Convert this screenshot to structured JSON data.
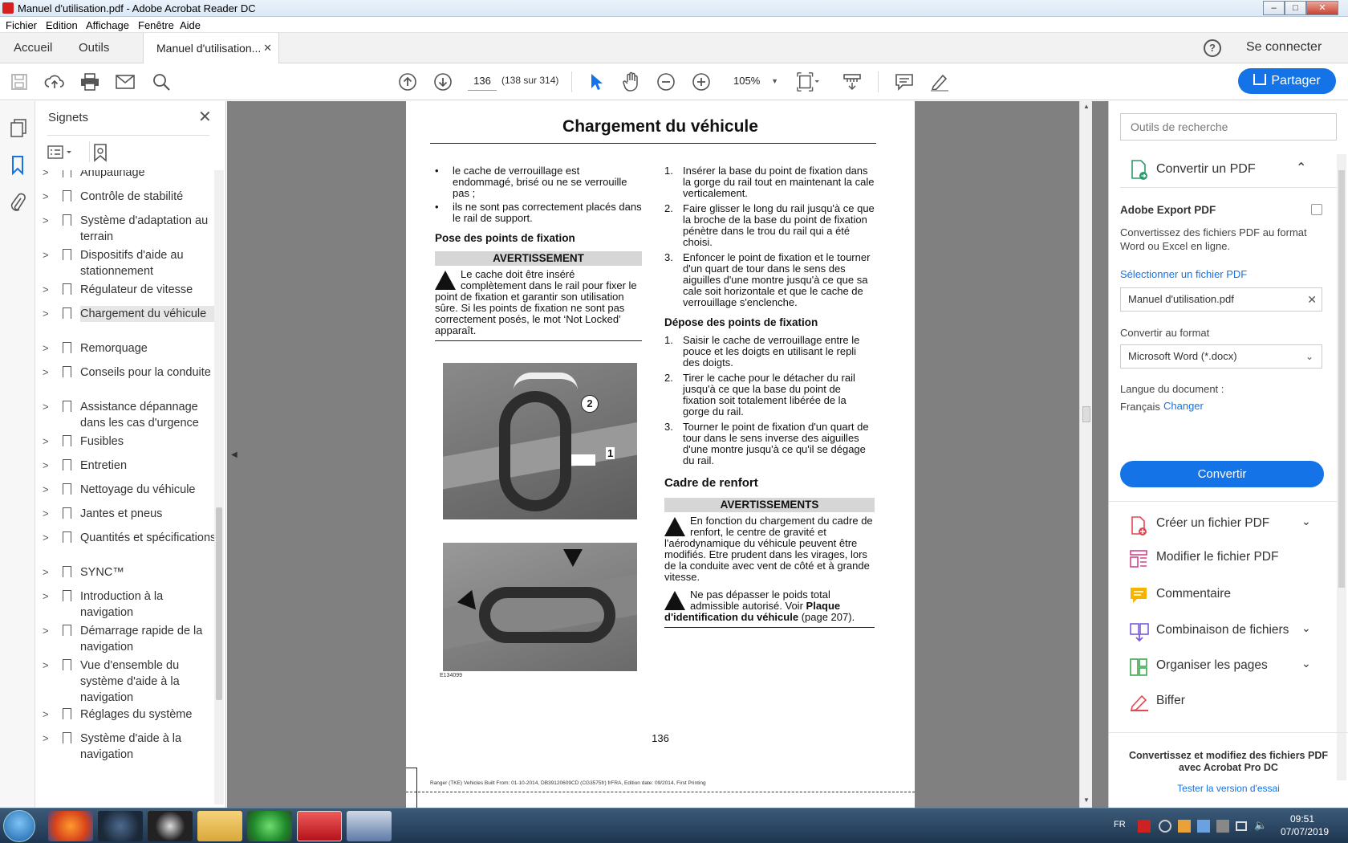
{
  "window": {
    "title": "Manuel d'utilisation.pdf - Adobe Acrobat Reader DC",
    "min_label": "–",
    "max_label": "□",
    "close_label": "✕"
  },
  "menu": [
    "Fichier",
    "Edition",
    "Affichage",
    "Fenêtre",
    "Aide"
  ],
  "tabs": {
    "home": "Accueil",
    "tools": "Outils",
    "doc": "Manuel d'utilisation...",
    "help": "?",
    "login": "Se connecter"
  },
  "toolbar": {
    "page_number": "136",
    "page_count": "(138 sur 314)",
    "zoom": "105%",
    "share": "Partager"
  },
  "bookmarks": {
    "title": "Signets",
    "items": [
      "Antipatinage",
      "Contrôle de stabilité",
      "Système d'adaptation au terrain",
      "Dispositifs d'aide au stationnement",
      "Régulateur de vitesse",
      "Chargement du véhicule",
      "Remorquage",
      "Conseils pour la conduite",
      "Assistance dépannage dans les cas d'urgence",
      "Fusibles",
      "Entretien",
      "Nettoyage du véhicule",
      "Jantes et pneus",
      "Quantités et spécifications",
      "SYNC™",
      "Introduction à la navigation",
      "Démarrage rapide de la navigation",
      "Vue d'ensemble du système d'aide à la navigation",
      "Réglages du système",
      "Système d'aide à la navigation"
    ]
  },
  "page": {
    "heading": "Chargement du véhicule",
    "left": {
      "bullets": [
        "le cache de verrouillage est endommagé, brisé ou ne se verrouille pas ;",
        "ils ne sont pas correctement placés dans le rail de support."
      ],
      "sub1": "Pose des points de fixation",
      "warn_label": "AVERTISSEMENT",
      "warn_text": "Le cache doit être inséré complètement dans le rail pour fixer le point de fixation et garantir son utilisation sûre. Si les points de fixation ne sont pas correctement posés, le mot ‘Not Locked’ apparaît.",
      "callout_2": "2",
      "callout_1": "1",
      "figure_code": "E134099"
    },
    "right": {
      "steps1": [
        "Insérer la base du point de fixation dans la gorge du rail tout en maintenant la cale verticalement.",
        "Faire glisser le long du rail jusqu'à ce que la broche de la base du point de fixation pénètre dans le trou du rail qui a été choisi.",
        "Enfoncer le point de fixation et le tourner d'un quart de tour dans le sens des aiguilles d'une montre jusqu'à ce que sa cale soit horizontale et que le cache de verrouillage s'enclenche."
      ],
      "sub2": "Dépose des points de fixation",
      "steps2": [
        "Saisir le cache de verrouillage entre le pouce et les doigts en utilisant le repli des doigts.",
        "Tirer le cache pour le détacher du rail jusqu'à ce que la base du point de fixation soit totalement libérée de la gorge du rail.",
        "Tourner le point de fixation d'un quart de tour dans le sens inverse des aiguilles d'une montre jusqu'à ce qu'il se dégage du rail."
      ],
      "step_nums": [
        "1.",
        "2.",
        "3."
      ],
      "sub3": "Cadre de renfort",
      "warns_label": "AVERTISSEMENTS",
      "warn1": "En fonction du chargement du cadre de renfort, le centre de gravité et l'aérodynamique du véhicule peuvent être modifiés. Etre prudent dans les virages, lors de la conduite avec vent de côté et à grande vitesse.",
      "warn2_pre": "Ne pas dépasser le poids total admissible autorisé.  Voir",
      "warn2_bold": "Plaque d'identification du véhicule",
      "warn2_post": "(page 207)."
    },
    "page_number": "136",
    "footer": "Ranger (TKE) Vehicles Built From: 01-10-2014, DB39120609CD (CG3575fr) frFRA, Edition date: 09/2014, First Printing"
  },
  "right_panel": {
    "search_placeholder": "Outils de recherche",
    "convert_title": "Convertir un PDF",
    "export_title": "Adobe Export PDF",
    "export_desc": "Convertissez des fichiers PDF au format Word ou Excel en ligne.",
    "select_label": "Sélectionner un fichier PDF",
    "file_name": "Manuel d'utilisation.pdf",
    "format_label": "Convertir au format",
    "format_value": "Microsoft Word (*.docx)",
    "lang_label": "Langue du document :",
    "lang_value": "Français",
    "lang_change": "Changer",
    "convert_button": "Convertir",
    "tools": [
      "Créer un fichier PDF",
      "Modifier le fichier PDF",
      "Commentaire",
      "Combinaison de fichiers",
      "Organiser les pages",
      "Biffer"
    ],
    "promo": "Convertissez et modifiez des fichiers PDF avec Acrobat Pro DC",
    "trial": "Tester la version d'essai"
  },
  "taskbar": {
    "lang": "FR",
    "time": "09:51",
    "date": "07/07/2019"
  },
  "colors": {
    "accent": "#1473e6"
  }
}
